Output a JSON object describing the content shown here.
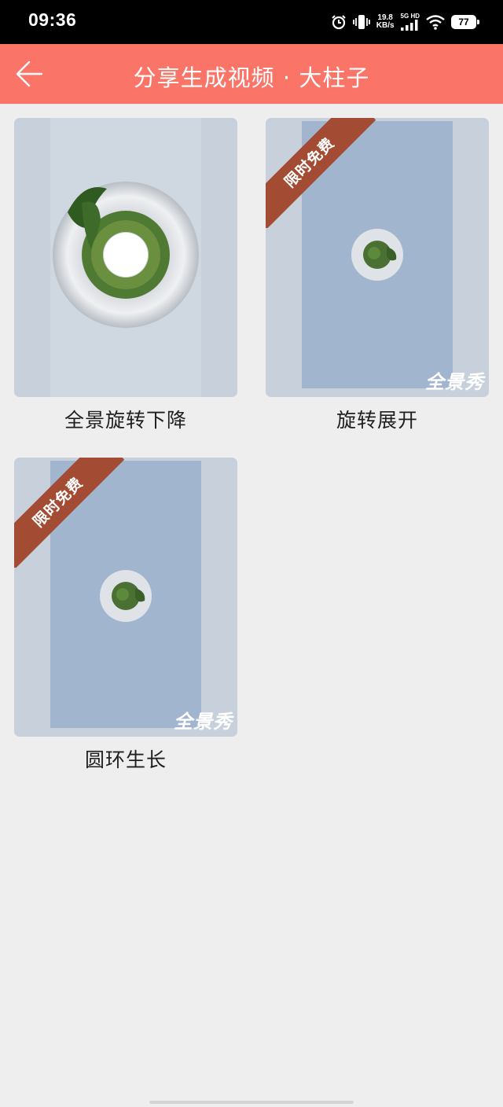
{
  "status_bar": {
    "time": "09:36",
    "net_speed_value": "19.8",
    "net_speed_unit": "KB/s",
    "signal_label": "5G HD",
    "battery": "77"
  },
  "header": {
    "title": "分享生成视频 · 大柱子",
    "back_icon": "back-arrow-icon",
    "background_color": "#fb7468"
  },
  "cards": [
    {
      "label": "全景旋转下降",
      "badge": "",
      "watermark": ""
    },
    {
      "label": "旋转展开",
      "badge": "限时免费",
      "watermark": "全景秀"
    },
    {
      "label": "圆环生长",
      "badge": "限时免费",
      "watermark": "全景秀"
    }
  ],
  "colors": {
    "badge": "#a34c33",
    "thumb_bg": "#c7d0db",
    "frame_bg": "#a2b5cf"
  }
}
